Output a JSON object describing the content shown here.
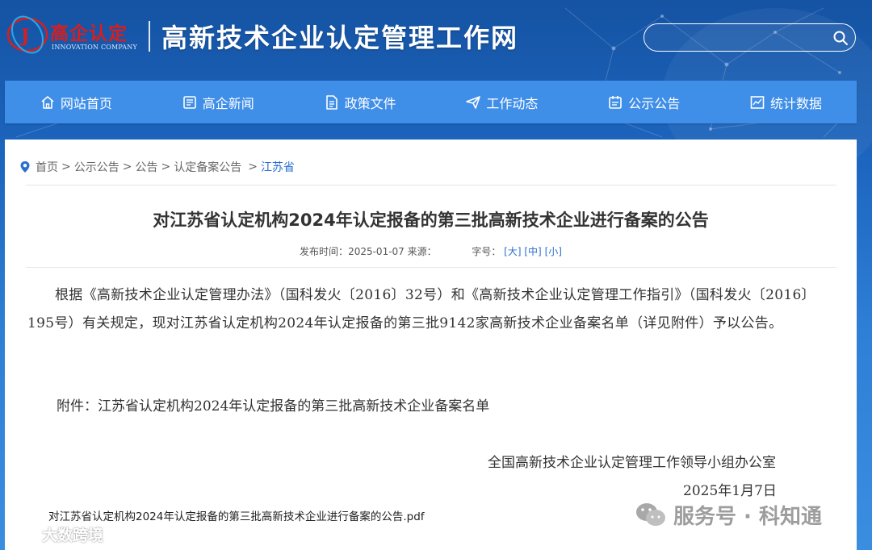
{
  "header": {
    "logo_cn": "高企认定",
    "logo_en": "INNOVATION COMPANY",
    "site_title": "高新技术企业认定管理工作网",
    "search_placeholder": ""
  },
  "nav": {
    "items": [
      {
        "label": "网站首页",
        "icon": "home-icon"
      },
      {
        "label": "高企新闻",
        "icon": "news-icon"
      },
      {
        "label": "政策文件",
        "icon": "document-icon"
      },
      {
        "label": "工作动态",
        "icon": "paper-plane-icon"
      },
      {
        "label": "公示公告",
        "icon": "notice-icon"
      },
      {
        "label": "统计数据",
        "icon": "chart-icon"
      }
    ]
  },
  "breadcrumb": {
    "items": [
      "首页",
      "公示公告",
      "公告",
      "认定备案公告"
    ],
    "separator": ">",
    "current": "江苏省"
  },
  "article": {
    "title": "对江苏省认定机构2024年认定报备的第三批高新技术企业进行备案的公告",
    "publish_label": "发布时间：",
    "publish_date": "2025-01-07",
    "source_label": "来源：",
    "font_label": "字号：",
    "font_large": "[大]",
    "font_medium": "[中]",
    "font_small": "[小]",
    "body": "根据《高新技术企业认定管理办法》（国科发火〔2016〕32号）和《高新技术企业认定管理工作指引》（国科发火〔2016〕195号）有关规定，现对江苏省认定机构2024年认定报备的第三批9142家高新技术企业备案名单（详见附件）予以公告。",
    "attachment": "附件：江苏省认定机构2024年认定报备的第三批高新技术企业备案名单",
    "signer": "全国高新技术企业认定管理工作领导小组办公室",
    "date": "2025年1月7日",
    "pdf_link": "对江苏省认定机构2024年认定报备的第三批高新技术企业进行备案的公告.pdf"
  },
  "watermarks": {
    "right": "服务号 · 科知通",
    "left": "大数跨境"
  },
  "colors": {
    "nav_bg": "#3f8ee8",
    "header_bg": "#1553a3",
    "link_blue": "#2a6fcf",
    "logo_red": "#d81e1e"
  }
}
